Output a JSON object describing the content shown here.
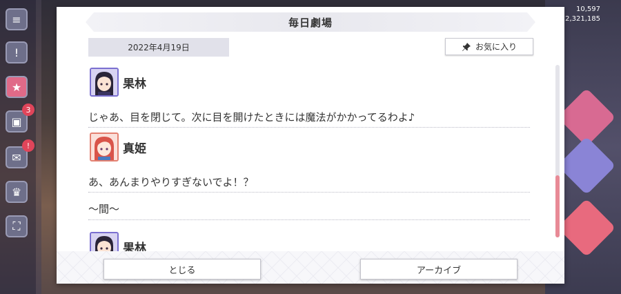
{
  "dialog": {
    "title": "毎日劇場",
    "date": "2022年4月19日",
    "favorite_label": "お気に入り",
    "close_label": "とじる",
    "archive_label": "アーカイブ"
  },
  "script": [
    {
      "speaker": "果林",
      "text": "じゃあ、目を閉じて。次に目を開けたときには魔法がかかってるわよ♪"
    },
    {
      "speaker": "真姫",
      "text": "あ、あんまりやりすぎないでよ！？"
    },
    {
      "narration": "〜間〜"
    },
    {
      "speaker": "果林"
    }
  ],
  "background": {
    "top_right_numbers": [
      "10,597",
      "2,321,185"
    ],
    "badges": [
      "3",
      "!"
    ]
  },
  "colors": {
    "accent_scroll": "#e88a96",
    "avatar_purple": "#7a6fd0",
    "avatar_pink": "#e38070"
  }
}
